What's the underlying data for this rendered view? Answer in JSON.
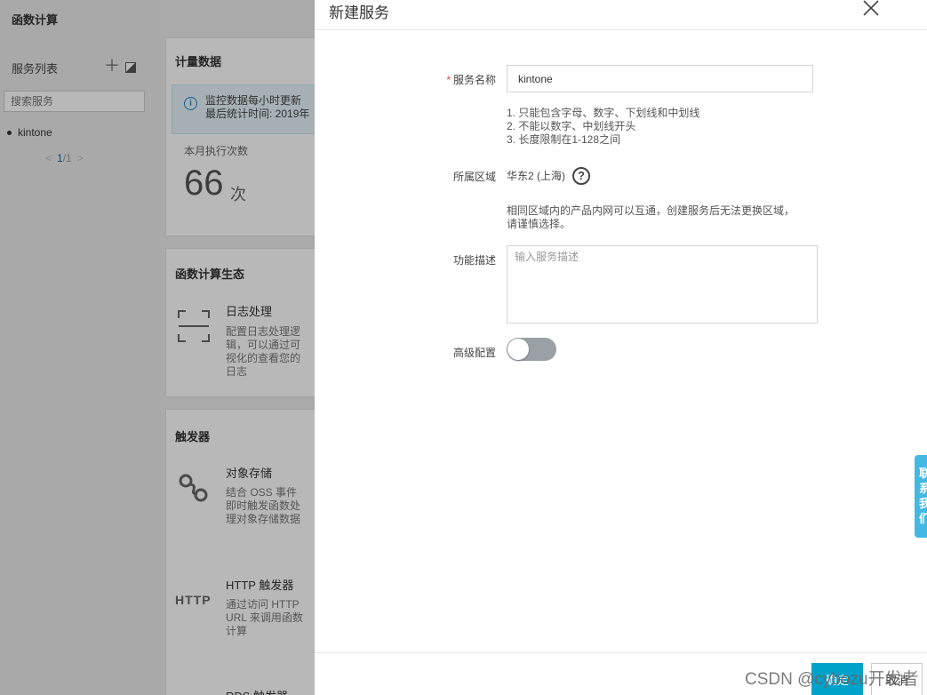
{
  "sidebar": {
    "title": "函数计算",
    "list_title": "服务列表",
    "search_placeholder": "搜索服务",
    "services": [
      "kintone"
    ],
    "pager": {
      "current": "1",
      "total": "/1"
    }
  },
  "metrics_card": {
    "title": "计量数据",
    "info_line1": "监控数据每小时更新",
    "info_line2": "最后统计时间: 2019年",
    "label": "本月执行次数",
    "value": "66",
    "unit": "次"
  },
  "eco_card": {
    "title": "函数计算生态",
    "items": [
      {
        "name": "日志处理",
        "desc": "配置日志处理逻辑，可以通过可视化的查看您的日志"
      }
    ]
  },
  "trigger_card": {
    "title": "触发器",
    "items": [
      {
        "name": "对象存储",
        "desc": "结合 OSS 事件即时触发函数处理对象存储数据"
      },
      {
        "name": "HTTP 触发器",
        "icon_text": "HTTP",
        "desc": "通过访问 HTTP URL 来调用函数计算"
      },
      {
        "name": "RDS 触发器"
      }
    ]
  },
  "drawer": {
    "title": "新建服务",
    "name_label": "服务名称",
    "required_mark": "*",
    "name_value": "kintone",
    "hints": [
      "1. 只能包含字母、数字、下划线和中划线",
      "2. 不能以数字、中划线开头",
      "3. 长度限制在1-128之间"
    ],
    "region_label": "所属区域",
    "region_value": "华东2 (上海)",
    "help_icon": "?",
    "region_note": "相同区域内的产品内网可以互通，创建服务后无法更换区域，请谨慎选择。",
    "desc_label": "功能描述",
    "desc_placeholder": "输入服务描述",
    "advanced_label": "高级配置",
    "advanced_enabled": false,
    "ok_label": "确定",
    "cancel_label": "取消"
  },
  "contact_tab": "联系我们",
  "watermark": "CSDN @cybozu开发者",
  "colors": {
    "primary": "#00a2ca",
    "required": "#e44444",
    "info_bg": "#e6f4fb",
    "contact": "#42b8e2"
  }
}
